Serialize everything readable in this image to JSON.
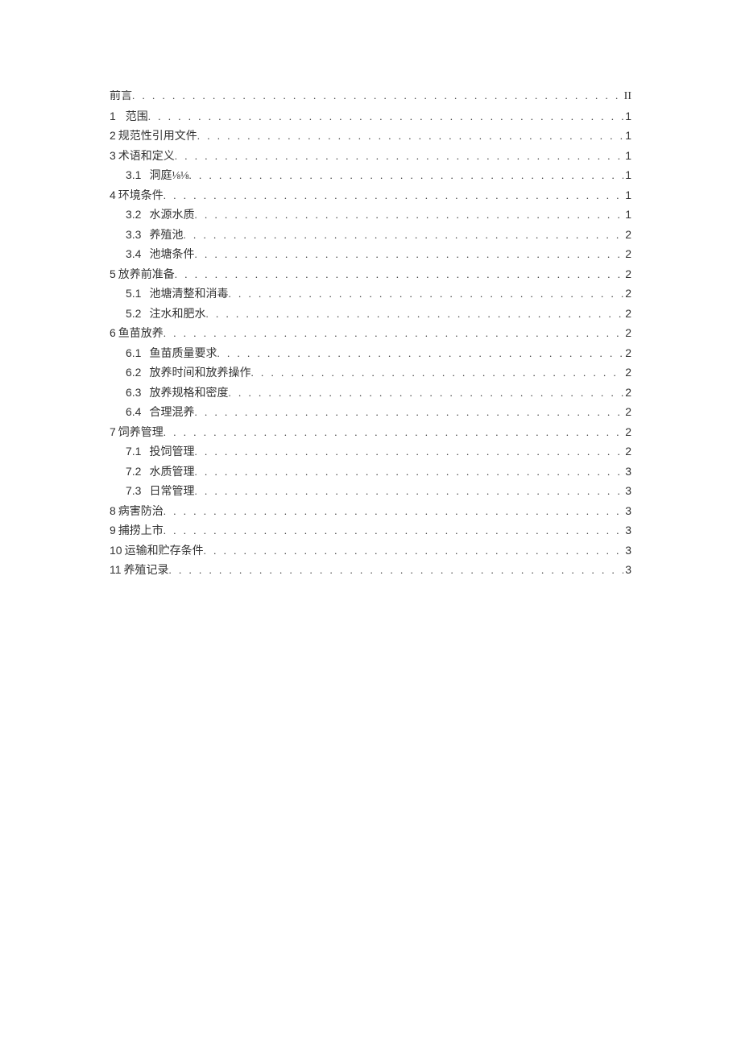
{
  "toc": [
    {
      "level": 0,
      "num": "",
      "title": "前言",
      "page": "II",
      "pageClass": "pg-roman"
    },
    {
      "level": 0,
      "num": "1",
      "title": "范围",
      "page": "1",
      "pageClass": "pg-num",
      "numSep": "wide"
    },
    {
      "level": 0,
      "num": "2",
      "title": "规范性引用文件",
      "page": "1",
      "pageClass": "pg-num"
    },
    {
      "level": 0,
      "num": "3",
      "title": "术语和定义",
      "page": "1",
      "pageClass": "pg-num"
    },
    {
      "level": 1,
      "num": "3.1",
      "title": "洞庭⅛⅛",
      "page": "1",
      "pageClass": "pg-num"
    },
    {
      "level": 0,
      "num": "4",
      "title": "环境条件",
      "page": "1",
      "pageClass": "pg-num"
    },
    {
      "level": 1,
      "num": "3.2",
      "title": "水源水质",
      "page": "1",
      "pageClass": "pg-num"
    },
    {
      "level": 1,
      "num": "3.3",
      "title": "养殖池",
      "page": "2",
      "pageClass": "pg-num"
    },
    {
      "level": 1,
      "num": "3.4",
      "title": "池塘条件",
      "page": "2",
      "pageClass": "pg-num"
    },
    {
      "level": 0,
      "num": "5",
      "title": "放养前准备",
      "page": "2",
      "pageClass": "pg-num"
    },
    {
      "level": 1,
      "num": "5.1",
      "title": "池塘清整和消毒",
      "page": "2",
      "pageClass": "pg-num"
    },
    {
      "level": 1,
      "num": "5.2",
      "title": "注水和肥水",
      "page": "2",
      "pageClass": "pg-num"
    },
    {
      "level": 0,
      "num": "6",
      "title": "鱼苗放养",
      "page": "2",
      "pageClass": "pg-num"
    },
    {
      "level": 1,
      "num": "6.1",
      "title": "鱼苗质量要求",
      "page": "2",
      "pageClass": "pg-num"
    },
    {
      "level": 1,
      "num": "6.2",
      "title": "放养时间和放养操作",
      "page": "2",
      "pageClass": "pg-num"
    },
    {
      "level": 1,
      "num": "6.3",
      "title": "放养规格和密度",
      "page": "2",
      "pageClass": "pg-num"
    },
    {
      "level": 1,
      "num": "6.4",
      "title": "合理混养",
      "page": "2",
      "pageClass": "pg-num"
    },
    {
      "level": 0,
      "num": "7",
      "title": "饲养管理",
      "page": "2",
      "pageClass": "pg-num"
    },
    {
      "level": 1,
      "num": "7.1",
      "title": "投饲管理",
      "page": "2",
      "pageClass": "pg-num"
    },
    {
      "level": 1,
      "num": "7.2",
      "title": "水质管理",
      "page": "3",
      "pageClass": "pg-num"
    },
    {
      "level": 1,
      "num": "7.3",
      "title": "日常管理",
      "page": "3",
      "pageClass": "pg-num"
    },
    {
      "level": 0,
      "num": "8",
      "title": "病害防治",
      "page": "3",
      "pageClass": "pg-num"
    },
    {
      "level": 0,
      "num": "9",
      "title": "捕捞上市",
      "page": "3",
      "pageClass": "pg-num"
    },
    {
      "level": 0,
      "num": "10",
      "title": "运输和贮存条件",
      "page": "3",
      "pageClass": "pg-num",
      "numStyle": "sans"
    },
    {
      "level": 0,
      "num": "11",
      "title": "养殖记录",
      "page": "3",
      "pageClass": "pg-num",
      "numStyle": "sans"
    }
  ]
}
